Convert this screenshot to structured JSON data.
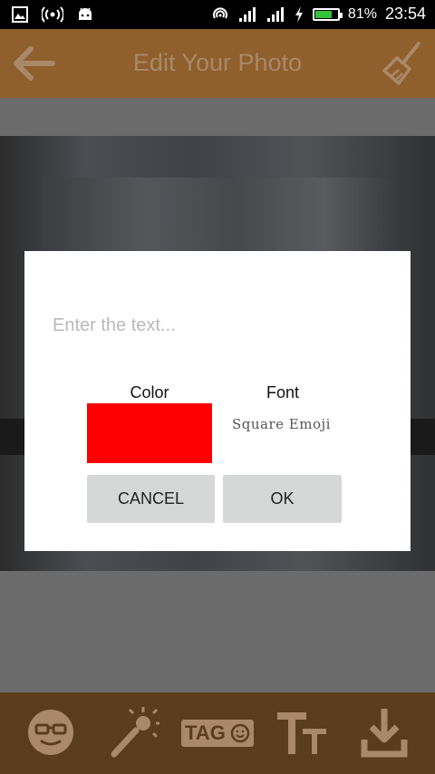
{
  "status_bar": {
    "battery_percent": "81%",
    "time": "23:54",
    "battery_level": 0.81,
    "icons": [
      "gallery-icon",
      "hotspot-icon",
      "android-icon",
      "nfc-icon",
      "signal-icon",
      "signal-icon",
      "charging-icon",
      "battery-icon"
    ]
  },
  "toolbar": {
    "title": "Edit Your Photo",
    "back_icon": "back-arrow-icon",
    "clear_icon": "broom-icon"
  },
  "dialog": {
    "input_placeholder": "Enter the text...",
    "input_value": "",
    "color_label": "Color",
    "font_label": "Font",
    "selected_color": "#ff0000",
    "font_name": "Square Emoji",
    "cancel_label": "CANCEL",
    "ok_label": "OK"
  },
  "bottom_tools": {
    "items": [
      "emoji-sticker-icon",
      "magic-wand-icon",
      "tag-sticker-icon",
      "text-size-icon",
      "download-icon"
    ],
    "tag_label": "TAG"
  },
  "colors": {
    "toolbar": "#8f5f2c",
    "toolbar_dim_text": "#a9896a",
    "bottom_bar": "#5b3c1c",
    "dialog_button": "#d6d7d7"
  }
}
